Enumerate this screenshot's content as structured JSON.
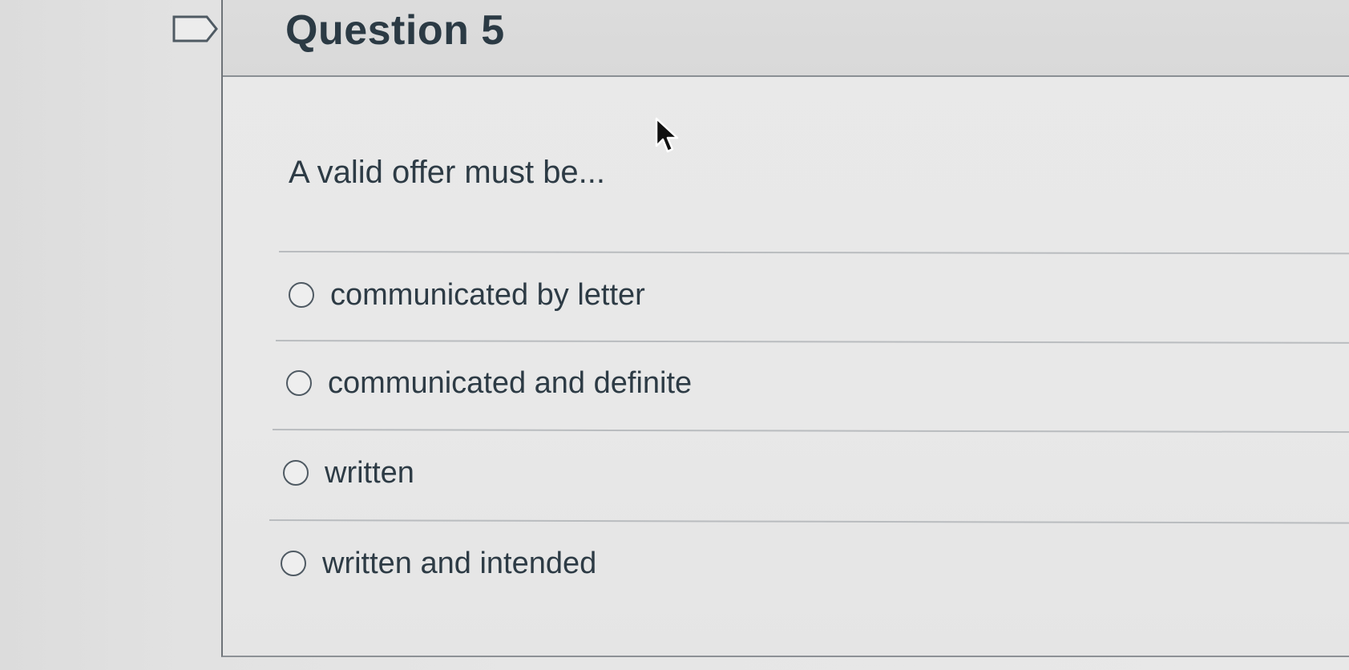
{
  "question": {
    "title": "Question 5",
    "text": "A valid offer must be...",
    "answers": [
      {
        "label": "communicated by letter",
        "selected": false
      },
      {
        "label": "communicated and definite",
        "selected": false
      },
      {
        "label": "written",
        "selected": false
      },
      {
        "label": "written and intended",
        "selected": false
      }
    ]
  },
  "icons": {
    "flag": "flag-outline-icon",
    "cursor": "mouse-pointer-icon"
  },
  "colors": {
    "text": "#2d3b45",
    "border": "#6e7378",
    "header_bg": "#dcdcdc",
    "card_bg": "#e8e8e8"
  }
}
